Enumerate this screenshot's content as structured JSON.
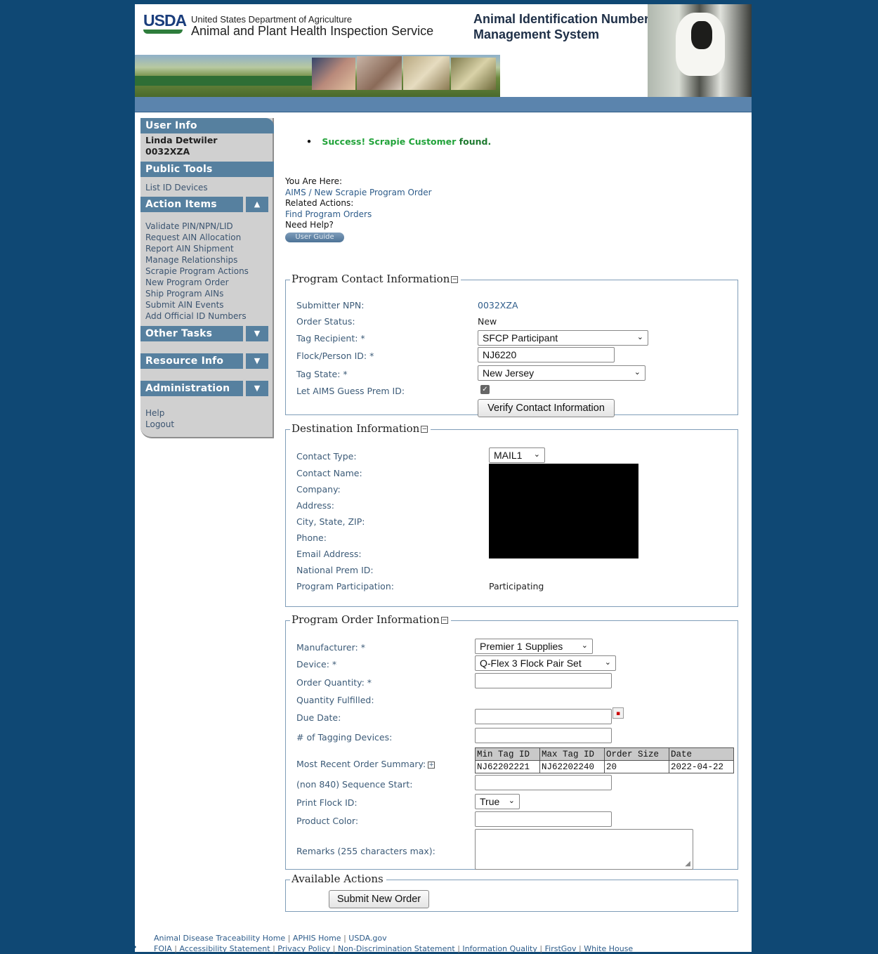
{
  "header": {
    "logo": "USDA",
    "agency_line1": "United States Department of Agriculture",
    "agency_line2": "Animal and Plant Health Inspection Service",
    "system_title_line1": "Animal Identification Number",
    "system_title_line2": "Management System"
  },
  "sidebar": {
    "user_info_title": "User Info",
    "user_name": "Linda Detwiler",
    "user_id": "0032XZA",
    "public_tools_title": "Public Tools",
    "public_tools_items": [
      "List ID Devices"
    ],
    "action_items_title": "Action Items",
    "action_items": [
      "Validate PIN/NPN/LID",
      "Request AIN Allocation",
      "Report AIN Shipment",
      "Manage Relationships",
      "Scrapie Program Actions",
      "New Program Order",
      "Ship Program AINs",
      "Submit AIN Events",
      "Add Official ID Numbers"
    ],
    "other_tasks_title": "Other Tasks",
    "resource_info_title": "Resource Info",
    "administration_title": "Administration",
    "bottom_links": [
      "Help",
      "Logout"
    ]
  },
  "status": {
    "success_message_green": "Success! Scrapie Customer",
    "success_message_bold": "found."
  },
  "nav": {
    "you_are_here_label": "You Are Here:",
    "breadcrumb": "AIMS / New Scrapie Program Order",
    "related_actions_label": "Related Actions:",
    "related_action": "Find Program Orders",
    "need_help_label": "Need Help?",
    "user_guide_button": "User Guide"
  },
  "contact": {
    "legend": "Program Contact Information",
    "submitter_npn_label": "Submitter NPN:",
    "submitter_npn": "0032XZA",
    "order_status_label": "Order Status:",
    "order_status": "New",
    "tag_recipient_label": "Tag Recipient: *",
    "tag_recipient": "SFCP Participant",
    "flock_id_label": "Flock/Person ID: *",
    "flock_id": "NJ6220",
    "tag_state_label": "Tag State: *",
    "tag_state": "New Jersey",
    "guess_prem_label": "Let AIMS Guess Prem ID:",
    "guess_prem_checked": true,
    "verify_button": "Verify Contact Information"
  },
  "destination": {
    "legend": "Destination Information",
    "contact_type_label": "Contact Type:",
    "contact_type": "MAIL1",
    "contact_name_label": "Contact Name:",
    "company_label": "Company:",
    "address_label": "Address:",
    "city_state_zip_label": "City, State, ZIP:",
    "phone_label": "Phone:",
    "email_label": "Email Address:",
    "national_prem_label": "National Prem ID:",
    "program_participation_label": "Program Participation:",
    "program_participation": "Participating"
  },
  "order": {
    "legend": "Program Order Information",
    "manufacturer_label": "Manufacturer: *",
    "manufacturer": "Premier 1 Supplies",
    "device_label": "Device: *",
    "device": "Q-Flex 3 Flock Pair Set",
    "order_quantity_label": "Order Quantity: *",
    "order_quantity": "",
    "quantity_fulfilled_label": "Quantity Fulfilled:",
    "due_date_label": "Due Date:",
    "due_date": "",
    "tagging_devices_label": "# of Tagging Devices:",
    "tagging_devices": "",
    "recent_summary_label": "Most Recent Order Summary:",
    "summary_headers": [
      "Min Tag ID",
      "Max Tag ID",
      "Order Size",
      "Date"
    ],
    "summary_row": [
      "NJ62202221",
      "NJ62202240",
      "20",
      "2022-04-22"
    ],
    "sequence_start_label": "(non 840) Sequence Start:",
    "sequence_start": "",
    "print_flock_label": "Print Flock ID:",
    "print_flock": "True",
    "product_color_label": "Product Color:",
    "product_color": "",
    "remarks_label": "Remarks (255 characters max):",
    "remarks": ""
  },
  "actions": {
    "legend": "Available Actions",
    "submit_button": "Submit New Order"
  },
  "footer": {
    "line1": [
      "Animal Disease Traceability Home",
      "APHIS Home",
      "USDA.gov"
    ],
    "line2": [
      "FOIA",
      "Accessibility Statement",
      "Privacy Policy",
      "Non-Discrimination Statement",
      "Information Quality",
      "FirstGov",
      "White House"
    ]
  },
  "colors": {
    "page_background": "#0f4874",
    "sidebar_header": "#56809f",
    "success_green": "#22a33a",
    "link_blue": "#2e5c8a",
    "label_blue": "#3c5b78"
  }
}
